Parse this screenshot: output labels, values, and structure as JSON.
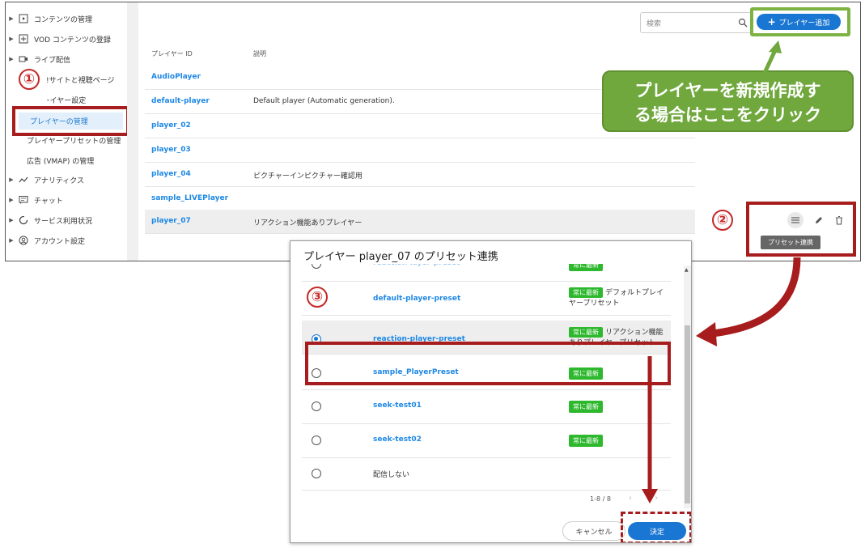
{
  "sidebar": {
    "items": [
      {
        "label": "コンテンツの管理",
        "icon": "play-square-icon",
        "caret": true
      },
      {
        "label": "VOD コンテンツの登録",
        "icon": "add-square-icon",
        "caret": true
      },
      {
        "label": "ライブ配信",
        "icon": "video-camera-icon",
        "caret": true
      },
      {
        "label": "!サイトと視聴ページ",
        "icon": "",
        "caret": false
      },
      {
        "label": "･イヤー設定",
        "icon": "",
        "caret": false
      },
      {
        "label": "プレイヤーの管理",
        "icon": "",
        "caret": false,
        "selected": true
      },
      {
        "label": "プレイヤープリセットの管理",
        "icon": "",
        "caret": false
      },
      {
        "label": "広告 (VMAP) の管理",
        "icon": "",
        "caret": false
      },
      {
        "label": "アナリティクス",
        "icon": "analytics-icon",
        "caret": true
      },
      {
        "label": "チャット",
        "icon": "chat-icon",
        "caret": true
      },
      {
        "label": "サービス利用状況",
        "icon": "usage-icon",
        "caret": true
      },
      {
        "label": "アカウント設定",
        "icon": "account-icon",
        "caret": true
      }
    ]
  },
  "toolbar": {
    "search_placeholder": "検索",
    "add_label": "プレイヤー追加"
  },
  "table": {
    "columns": [
      "プレイヤー ID",
      "説明"
    ],
    "rows": [
      {
        "id": "AudioPlayer",
        "desc": ""
      },
      {
        "id": "default-player",
        "desc": "Default player (Automatic generation)."
      },
      {
        "id": "player_02",
        "desc": ""
      },
      {
        "id": "player_03",
        "desc": ""
      },
      {
        "id": "player_04",
        "desc": "ピクチャーインピクチャー確認用"
      },
      {
        "id": "sample_LIVEPlayer",
        "desc": ""
      },
      {
        "id": "player_07",
        "desc": "リアクション機能ありプレイヤー",
        "selected": true
      }
    ],
    "tooltip": "プリセット連携"
  },
  "annotations": {
    "step1": "①",
    "step2": "②",
    "step3": "③",
    "callout_line1": "プレイヤーを新規作成す",
    "callout_line2": "る場合はここをクリック",
    "colors": {
      "red": "#a71c1c",
      "green": "#70a83d"
    }
  },
  "dialog": {
    "title": "プレイヤー player_07 のプリセット連携",
    "partial_top_name": "reaction-layer-preset",
    "presets": [
      {
        "name": "default-player-preset",
        "badge": "常に最新",
        "desc": "デフォルトプレイヤープリセット",
        "checked": false
      },
      {
        "name": "reaction-player-preset",
        "badge": "常に最新",
        "desc": "リアクション機能ありプレイヤープリセット",
        "checked": true
      },
      {
        "name": "sample_PlayerPreset",
        "badge": "常に最新",
        "desc": "",
        "checked": false
      },
      {
        "name": "seek-test01",
        "badge": "常に最新",
        "desc": "",
        "checked": false
      },
      {
        "name": "seek-test02",
        "badge": "常に最新",
        "desc": "",
        "checked": false
      },
      {
        "name": "配信しない",
        "badge": "",
        "desc": "",
        "checked": false
      }
    ],
    "pager": "1-8 / 8",
    "cancel_label": "キャンセル",
    "ok_label": "決定"
  }
}
